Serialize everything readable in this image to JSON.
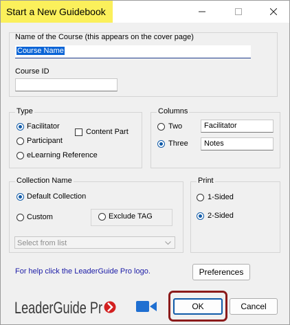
{
  "window": {
    "title": "Start a New Guidebook"
  },
  "course": {
    "name_label": "Name of the Course (this appears on the cover page)",
    "name_value": "Course Name",
    "id_label": "Course ID",
    "id_value": ""
  },
  "type": {
    "label": "Type",
    "facilitator": "Facilitator",
    "participant": "Participant",
    "elearning": "eLearning Reference",
    "content_part": "Content Part",
    "selected": "Facilitator"
  },
  "columns": {
    "label": "Columns",
    "two": "Two",
    "three": "Three",
    "selected": "Three",
    "col1_value": "Facilitator",
    "col2_value": "Notes"
  },
  "collection": {
    "label": "Collection Name",
    "default": "Default Collection",
    "custom": "Custom",
    "exclude_tag": "Exclude TAG",
    "selected": "Default Collection",
    "select_placeholder": "Select from list"
  },
  "print": {
    "label": "Print",
    "one_sided": "1-Sided",
    "two_sided": "2-Sided",
    "selected": "2-Sided"
  },
  "help_text": "For help click the LeaderGuide Pro logo.",
  "buttons": {
    "preferences": "Preferences",
    "ok": "OK",
    "cancel": "Cancel"
  },
  "logo": {
    "text": "LeaderGuide Pro"
  },
  "colors": {
    "highlight": "#fbf05b",
    "accent": "#0f5aa8",
    "link": "#1a1aa6",
    "ok_outline": "#8b1a1a",
    "logo_red": "#d32020",
    "camera_blue": "#1f6fd1"
  }
}
